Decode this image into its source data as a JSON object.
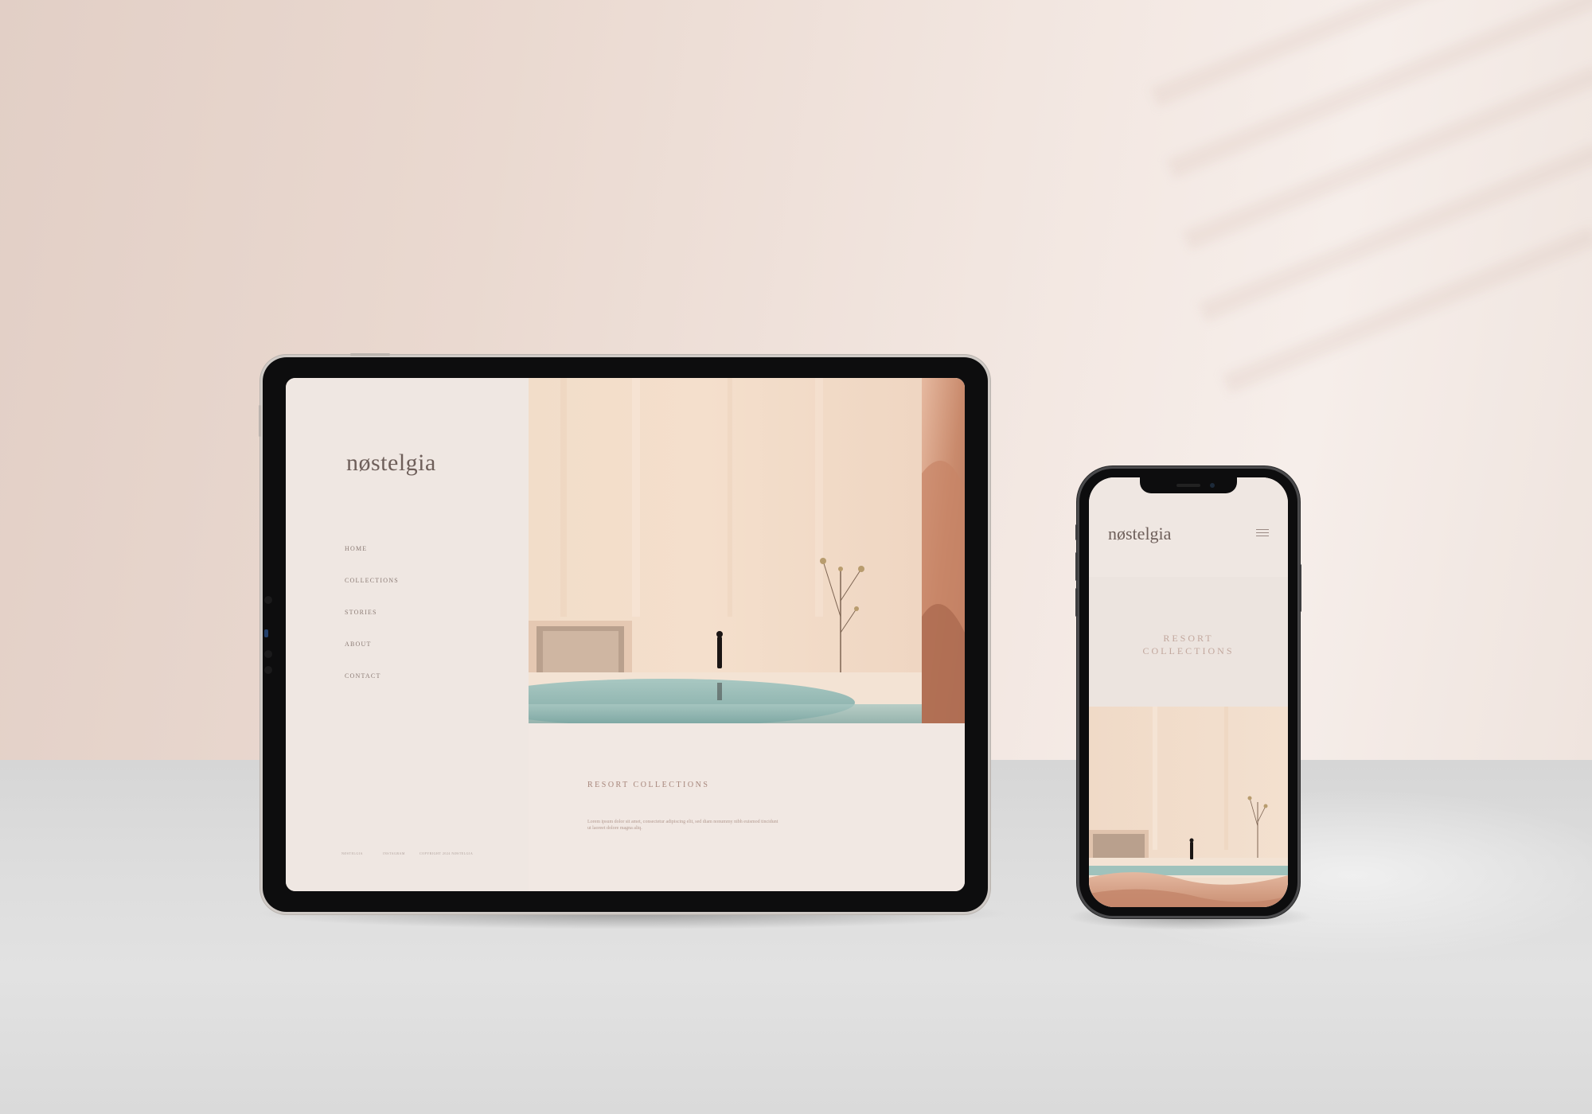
{
  "tablet": {
    "logo": "nøstelgia",
    "nav": [
      {
        "label": "HOME"
      },
      {
        "label": "COLLECTIONS"
      },
      {
        "label": "STORIES"
      },
      {
        "label": "ABOUT"
      },
      {
        "label": "CONTACT"
      }
    ],
    "footer": [
      "NØSTELGIA",
      "INSTAGRAM",
      "COPYRIGHT 2024 NØSTELGIA"
    ],
    "heading": "RESORT COLLECTIONS",
    "body_text": "Lorem ipsum dolor sit amet, consectetur adipiscing elit, sed diam nonummy nibh euismod tincidunt ut laoreet dolore magna aliq."
  },
  "phone": {
    "logo": "nøstelgia",
    "menu_icon": "hamburger-menu-icon",
    "title_line1": "RESORT",
    "title_line2": "COLLECTIONS"
  },
  "colors": {
    "logo": "#6e5f5a",
    "accent": "#a6857a",
    "screen_bg": "#f1e8e3"
  }
}
